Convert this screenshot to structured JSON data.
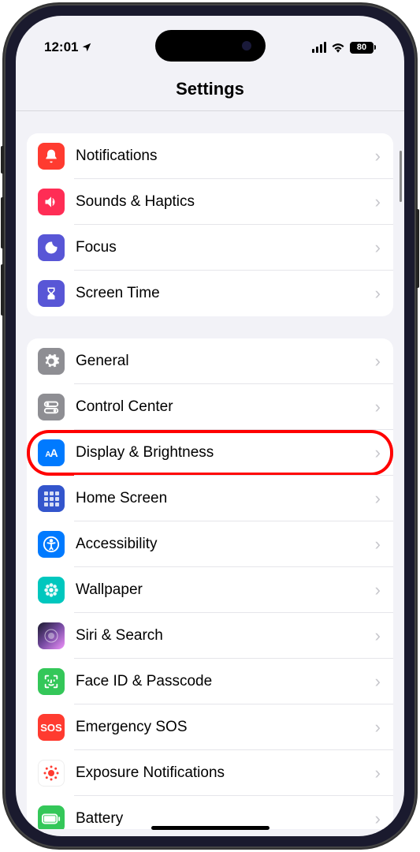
{
  "status": {
    "time": "12:01",
    "battery": "80"
  },
  "header": {
    "title": "Settings"
  },
  "sections": [
    {
      "rows": [
        {
          "label": "Notifications",
          "icon": "bell-icon",
          "iconClass": "ic-notif"
        },
        {
          "label": "Sounds & Haptics",
          "icon": "speaker-icon",
          "iconClass": "ic-sound"
        },
        {
          "label": "Focus",
          "icon": "moon-icon",
          "iconClass": "ic-focus"
        },
        {
          "label": "Screen Time",
          "icon": "hourglass-icon",
          "iconClass": "ic-screen"
        }
      ]
    },
    {
      "rows": [
        {
          "label": "General",
          "icon": "gear-icon",
          "iconClass": "ic-general"
        },
        {
          "label": "Control Center",
          "icon": "toggle-icon",
          "iconClass": "ic-control"
        },
        {
          "label": "Display & Brightness",
          "icon": "textsize-icon",
          "iconClass": "ic-display",
          "highlighted": true
        },
        {
          "label": "Home Screen",
          "icon": "grid-icon",
          "iconClass": "ic-home"
        },
        {
          "label": "Accessibility",
          "icon": "accessibility-icon",
          "iconClass": "ic-access"
        },
        {
          "label": "Wallpaper",
          "icon": "flower-icon",
          "iconClass": "ic-wallpaper"
        },
        {
          "label": "Siri & Search",
          "icon": "siri-icon",
          "iconClass": "ic-siri"
        },
        {
          "label": "Face ID & Passcode",
          "icon": "faceid-icon",
          "iconClass": "ic-faceid"
        },
        {
          "label": "Emergency SOS",
          "icon": "sos-icon",
          "iconClass": "ic-sos"
        },
        {
          "label": "Exposure Notifications",
          "icon": "exposure-icon",
          "iconClass": "ic-exposure"
        },
        {
          "label": "Battery",
          "icon": "battery-icon",
          "iconClass": "ic-battery"
        }
      ]
    }
  ],
  "sosText": "SOS"
}
